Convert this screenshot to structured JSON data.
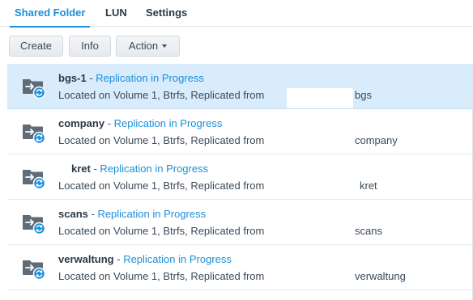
{
  "tabs": [
    {
      "label": "Shared Folder",
      "active": true
    },
    {
      "label": "LUN",
      "active": false
    },
    {
      "label": "Settings",
      "active": false
    }
  ],
  "toolbar": {
    "create_label": "Create",
    "info_label": "Info",
    "action_label": "Action"
  },
  "folders": [
    {
      "name": "bgs-1",
      "sep": " - ",
      "status": "Replication in Progress",
      "detail": "Located on Volume 1, Btrfs, Replicated from",
      "source": "bgs",
      "selected": true
    },
    {
      "name": "company",
      "sep": " - ",
      "status": "Replication in Progress",
      "detail": "Located on Volume 1, Btrfs, Replicated from",
      "source": "company",
      "selected": false
    },
    {
      "name": "kret",
      "sep": " - ",
      "status": "Replication in Progress",
      "detail": "Located on Volume 1, Btrfs, Replicated from",
      "source": "kret",
      "selected": false
    },
    {
      "name": "scans",
      "sep": " - ",
      "status": "Replication in Progress",
      "detail": "Located on Volume 1, Btrfs, Replicated from",
      "source": "scans",
      "selected": false
    },
    {
      "name": "verwaltung",
      "sep": " - ",
      "status": "Replication in Progress",
      "detail": "Located on Volume 1, Btrfs, Replicated from",
      "source": "verwaltung",
      "selected": false
    }
  ],
  "colors": {
    "accent": "#1b8fd9",
    "selected_row": "#d9ecfb",
    "folder_icon": "#5f6b76",
    "badge": "#1b8fd9"
  },
  "icons": {
    "folder": "shared-folder-replication-icon"
  }
}
